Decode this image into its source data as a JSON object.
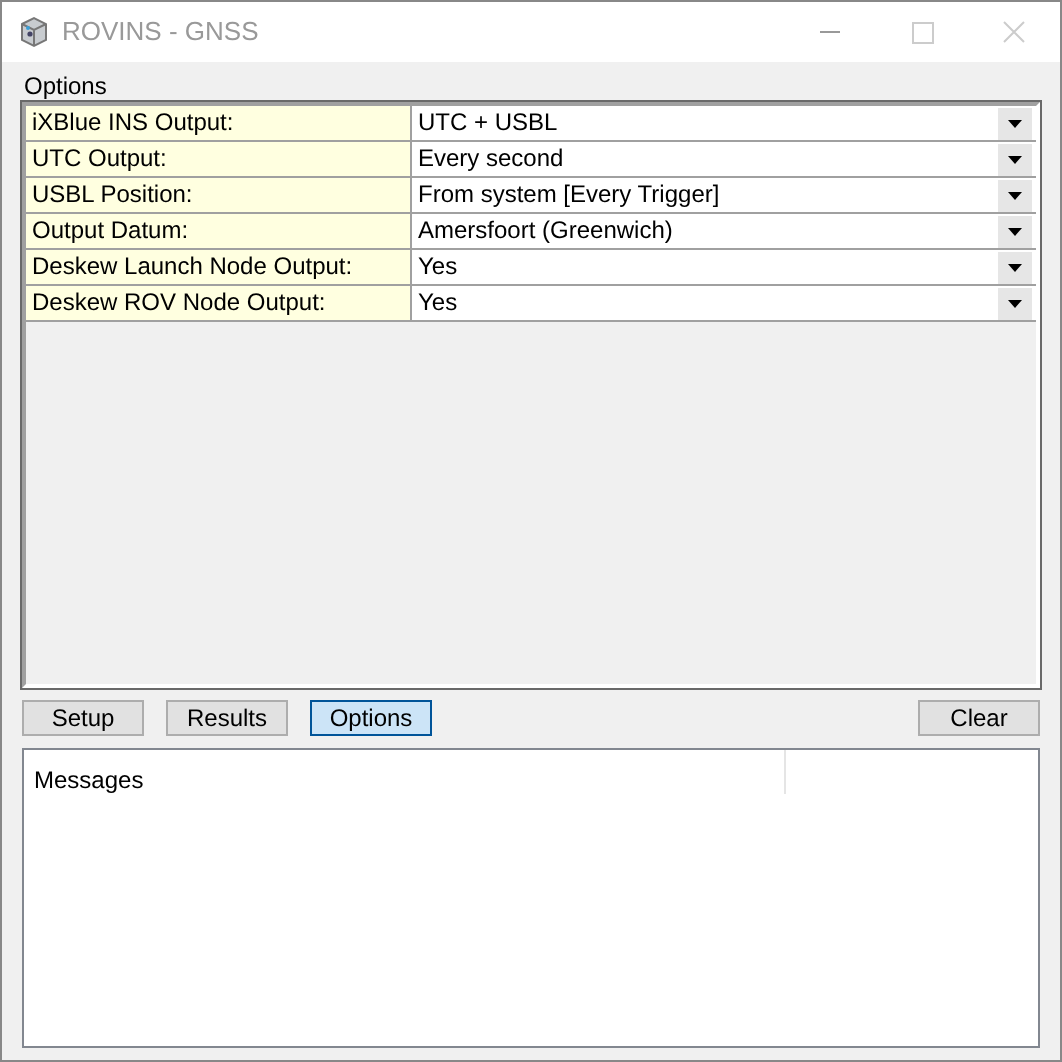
{
  "window": {
    "title": "ROVINS - GNSS"
  },
  "section_label": "Options",
  "properties": [
    {
      "label": "iXBlue INS Output:",
      "value": "UTC + USBL"
    },
    {
      "label": "UTC Output:",
      "value": "Every second"
    },
    {
      "label": "USBL Position:",
      "value": "From system [Every Trigger]"
    },
    {
      "label": "Output Datum:",
      "value": "Amersfoort (Greenwich)"
    },
    {
      "label": "Deskew Launch Node Output:",
      "value": "Yes"
    },
    {
      "label": "Deskew ROV Node Output:",
      "value": "Yes"
    }
  ],
  "view_buttons": [
    {
      "label": "Setup",
      "selected": false
    },
    {
      "label": "Results",
      "selected": false
    },
    {
      "label": "Options",
      "selected": true
    }
  ],
  "clear_button": "Clear",
  "messages": {
    "column_header": "Messages"
  }
}
